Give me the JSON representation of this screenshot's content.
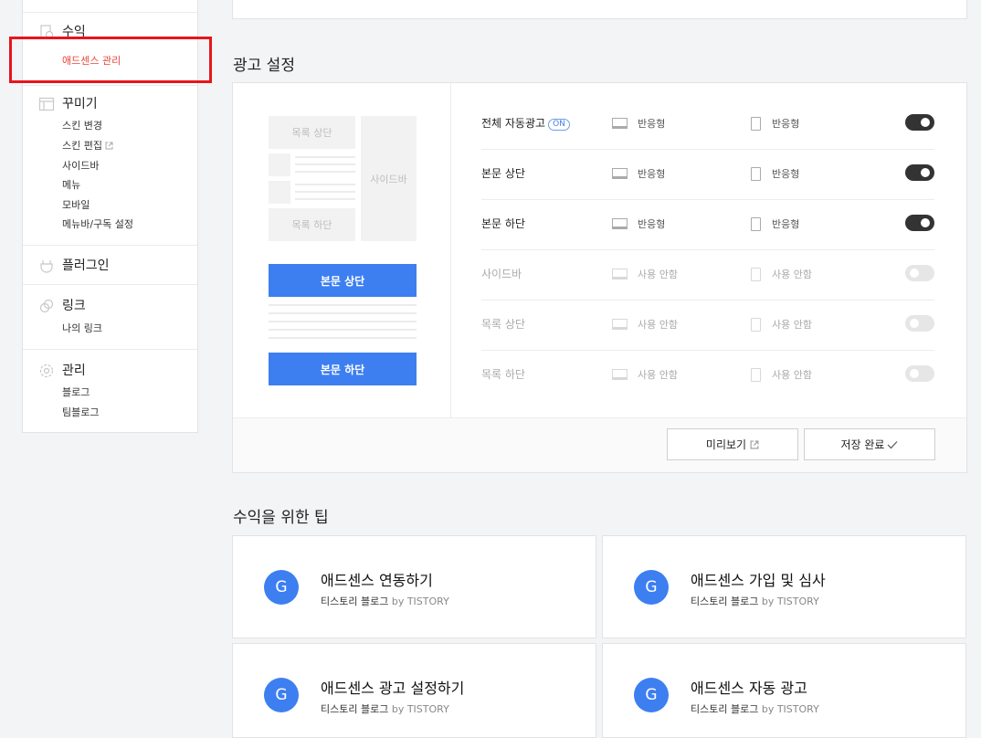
{
  "sidebar": {
    "revenue": {
      "title": "수익",
      "icon": "revenue-icon",
      "items": [
        "애드센스 관리"
      ]
    },
    "decorate": {
      "title": "꾸미기",
      "icon": "layout-icon",
      "items": [
        "스킨 변경",
        "스킨 편집",
        "사이드바",
        "메뉴",
        "모바일",
        "메뉴바/구독 설정"
      ]
    },
    "plugin": {
      "title": "플러그인",
      "icon": "plug-icon"
    },
    "link": {
      "title": "링크",
      "icon": "link-icon",
      "items": [
        "나의 링크"
      ]
    },
    "manage": {
      "title": "관리",
      "icon": "gear-icon",
      "items": [
        "블로그",
        "팀블로그"
      ]
    }
  },
  "ad_settings": {
    "title": "광고 설정",
    "preview": {
      "list_top": "목록 상단",
      "list_bottom": "목록 하단",
      "sidebar": "사이드바",
      "body_top": "본문 상단",
      "body_bottom": "본문 하단"
    },
    "rows": [
      {
        "label": "전체 자동광고",
        "badge": "ON",
        "pc": "반응형",
        "mobile": "반응형",
        "enabled": true
      },
      {
        "label": "본문 상단",
        "pc": "반응형",
        "mobile": "반응형",
        "enabled": true
      },
      {
        "label": "본문 하단",
        "pc": "반응형",
        "mobile": "반응형",
        "enabled": true
      },
      {
        "label": "사이드바",
        "pc": "사용 안함",
        "mobile": "사용 안함",
        "enabled": false
      },
      {
        "label": "목록 상단",
        "pc": "사용 안함",
        "mobile": "사용 안함",
        "enabled": false
      },
      {
        "label": "목록 하단",
        "pc": "사용 안함",
        "mobile": "사용 안함",
        "enabled": false
      }
    ],
    "preview_button": "미리보기",
    "save_button": "저장 완료"
  },
  "tips": {
    "title": "수익을 위한 팁",
    "cards": [
      {
        "avatar": "G",
        "title": "애드센스 연동하기",
        "source": "티스토리 블로그",
        "by": "by TISTORY"
      },
      {
        "avatar": "G",
        "title": "애드센스 가입 및 심사",
        "source": "티스토리 블로그",
        "by": "by TISTORY"
      },
      {
        "avatar": "G",
        "title": "애드센스 광고 설정하기",
        "source": "티스토리 블로그",
        "by": "by TISTORY"
      },
      {
        "avatar": "G",
        "title": "애드센스 자동 광고",
        "source": "티스토리 블로그",
        "by": "by TISTORY"
      }
    ]
  },
  "colors": {
    "accent": "#3d7ff0",
    "active_menu": "#ea4335",
    "highlight_box": "#e8141c",
    "toggle_on": "#333333",
    "toggle_off": "#e6e6e6"
  }
}
